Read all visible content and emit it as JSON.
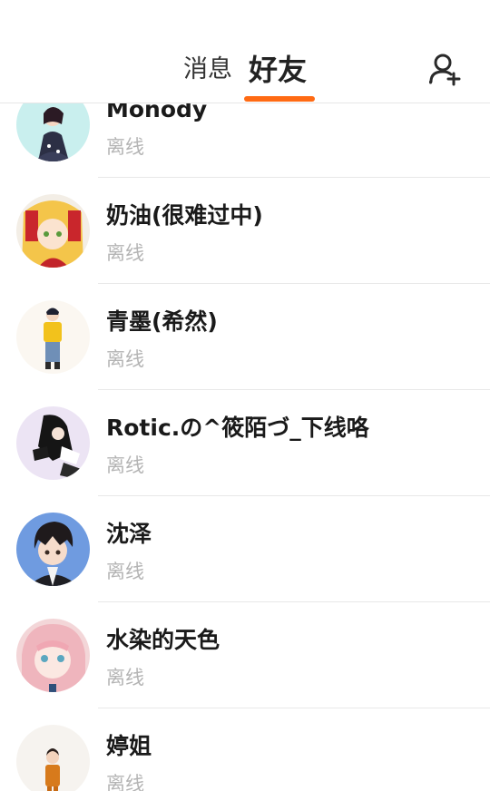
{
  "header": {
    "tabs": [
      {
        "label": "消息",
        "active": false
      },
      {
        "label": "好友",
        "active": true
      }
    ],
    "accent_color": "#ff6a13",
    "add_friend_icon": "person-add-icon"
  },
  "friends": [
    {
      "name": "Monody",
      "status": "离线"
    },
    {
      "name": "奶油(很难过中)",
      "status": "离线"
    },
    {
      "name": "青墨(希然)",
      "status": "离线"
    },
    {
      "name": "Rotic.の^筱陌づ_下线咯",
      "status": "离线"
    },
    {
      "name": "沈泽",
      "status": "离线"
    },
    {
      "name": "水染的天色",
      "status": "离线"
    },
    {
      "name": "婷姐",
      "status": "离线"
    }
  ]
}
